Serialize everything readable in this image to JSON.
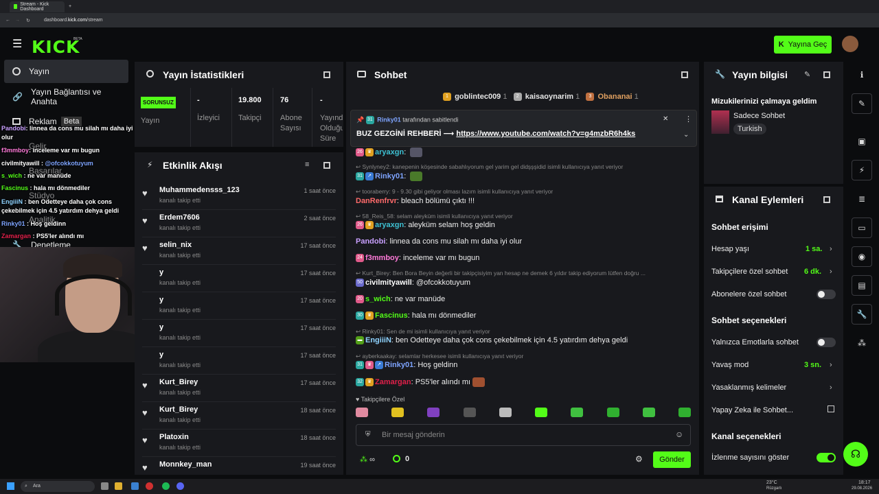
{
  "browser": {
    "tab_title": "Stream - Kick Dashboard",
    "url_prefix": "dashboard.",
    "url_domain": "kick.com",
    "url_path": "/stream"
  },
  "header": {
    "logo": "KICK",
    "beta": "BETA",
    "go_live_label": "Yayına Geç"
  },
  "nav": {
    "items": [
      {
        "label": "Yayın"
      },
      {
        "label": "Yayın Bağlantısı ve Anahta"
      },
      {
        "label": "Reklam",
        "badge": "Beta"
      },
      {
        "label": "Gelir"
      },
      {
        "label": "Başarılar"
      },
      {
        "label": "Stüdyo"
      },
      {
        "label": "Analitik"
      },
      {
        "label": "Denetleme"
      }
    ]
  },
  "overlay_chat": [
    {
      "user": "Pandobi",
      "text": "linnea da cons mu silah mı daha iyi olur"
    },
    {
      "user": "f3mmboy",
      "text": "inceleme var mı bugun"
    },
    {
      "user": "civilmityawill",
      "text": "@ofcokkotuyum"
    },
    {
      "user": "s_wich",
      "text": "ne var manüde"
    },
    {
      "user": "Fascinus",
      "text": "hala mı dönmediler"
    },
    {
      "user": "EngiiiN",
      "text": "ben Odetteye daha çok cons çekebilmek için 4.5 yatırdım dehya geldi"
    },
    {
      "user": "Rinky01",
      "text": "Hoş geldinn"
    },
    {
      "user": "Zamargan",
      "text": "PS5'ler alındı mı"
    }
  ],
  "stats": {
    "title": "Yayın İstatistikleri",
    "status": "SORUNSUZ",
    "status_label": "Yayın",
    "viewers_value": "-",
    "viewers_label": "İzleyici",
    "followers_value": "19.800",
    "followers_label": "Takipçi",
    "subs_value": "76",
    "subs_label": "Abone Sayısı",
    "uptime_value": "-",
    "uptime_label": "Yayında Olduğu Süre"
  },
  "activity": {
    "title": "Etkinlik Akışı",
    "items": [
      {
        "name": "Muhammedensss_123",
        "sub": "kanalı takip etti",
        "time": "1 saat önce"
      },
      {
        "name": "Erdem7606",
        "sub": "kanalı takip etti",
        "time": "2 saat önce"
      },
      {
        "name": "selin_nix",
        "sub": "kanalı takip etti",
        "time": "17 saat önce"
      },
      {
        "name": "y",
        "sub": "kanalı takip etti",
        "time": "17 saat önce"
      },
      {
        "name": "y",
        "sub": "kanalı takip etti",
        "time": "17 saat önce"
      },
      {
        "name": "y",
        "sub": "kanalı takip etti",
        "time": "17 saat önce"
      },
      {
        "name": "y",
        "sub": "kanalı takip etti",
        "time": "17 saat önce"
      },
      {
        "name": "Kurt_Birey",
        "sub": "kanalı takip etti",
        "time": "17 saat önce"
      },
      {
        "name": "Kurt_Birey",
        "sub": "kanalı takip etti",
        "time": "18 saat önce"
      },
      {
        "name": "Platoxin",
        "sub": "kanalı takip etti",
        "time": "18 saat önce"
      },
      {
        "name": "Monnkey_man",
        "sub": "",
        "time": "19 saat önce"
      }
    ]
  },
  "chat": {
    "title": "Sohbet",
    "top_gifters": [
      {
        "rank": "1",
        "name": "goblintec009",
        "count": "1"
      },
      {
        "rank": "2",
        "name": "kaisaoynarim",
        "count": "1"
      },
      {
        "rank": "3",
        "name": "Obananai",
        "count": "1"
      }
    ],
    "pinned": {
      "by_user": "Rinky01",
      "by_text": "tarafından sabitlendi",
      "text": "BUZ GEZGİNİ REHBERİ ⟶",
      "link": "https://www.youtube.com/watch?v=g4mzbR6h4ks"
    },
    "messages": [
      {
        "badge": "26",
        "user": "aryaxgn",
        "text": "",
        "color": "#3ec1d3"
      },
      {
        "reply": "Synlyney2: kanepenin köşesinde sabahlıyorum gel yarim gel didşşşidid isimli kullanıcıya yanıt veriyor"
      },
      {
        "badge": "31",
        "user": "Rinky01",
        "text": "",
        "color": "#7ea4ff"
      },
      {
        "reply": "tooraberry: 9 - 9.30 gibi geliyor olması lazım isimli kullanıcıya yanıt veriyor"
      },
      {
        "badge": "",
        "user": "DanRenfrvr",
        "text": "bleach bölümü çıktı !!!",
        "color": "#ff6b6b"
      },
      {
        "reply": "58_Reis_58: selam aleyküm isimli kullanıcıya yanıt veriyor"
      },
      {
        "badge": "26",
        "user": "aryaxgn",
        "text": "aleyküm selam hoş geldin",
        "color": "#3ec1d3"
      },
      {
        "badge": "",
        "user": "Pandobi",
        "text": "linnea da cons mu silah mı daha iyi olur",
        "color": "#c9a0ff"
      },
      {
        "badge": "24",
        "user": "f3mmboy",
        "text": "inceleme var mı bugun",
        "color": "#ff7ad9"
      },
      {
        "reply": "Kurt_Birey: Ben Bora Beyin değerli bir takipçisiyim yan hesap ne demek 6 yıldır takip ediyorum lütfen doğru ..."
      },
      {
        "badge": "50",
        "user": "civilmityawill",
        "text": "@ofcokkotuyum",
        "color": "#ffffff"
      },
      {
        "badge": "20",
        "user": "s_wich",
        "text": "ne var manüde",
        "color": "#53fc18"
      },
      {
        "badge": "30",
        "user": "Fascinus",
        "text": "hala mı dönmediler",
        "color": "#53fc18"
      },
      {
        "reply": "Rinky01: Sen de mi isimli kullanıcıya yanıt veriyor"
      },
      {
        "badge": "",
        "user": "EngiiiN",
        "text": "ben Odetteye daha çok cons çekebilmek için 4.5 yatırdım dehya geldi",
        "color": "#8fd3ff"
      },
      {
        "reply": "ayberkaakay: selamlar herkesee isimli kullanıcıya yanıt veriyor"
      },
      {
        "badge": "31",
        "user": "Rinky01",
        "text": "Hoş geldinn",
        "color": "#7ea4ff"
      },
      {
        "badge": "32",
        "user": "Zamargan",
        "text": "PS5'ler alındı mı",
        "color": "#e0204a"
      }
    ],
    "followers_only": "Takipçilere Özel",
    "input_placeholder": "Bir mesaj gönderin",
    "points_value": "0",
    "send_label": "Gönder"
  },
  "stream_info": {
    "title": "Yayın bilgisi",
    "stream_title": "Mizukilerinizi çalmaya geldim",
    "category": "Sadece Sohbet",
    "language": "Turkish"
  },
  "channel_actions": {
    "title": "Kanal Eylemleri",
    "chat_access_header": "Sohbet erişimi",
    "account_age_label": "Hesap yaşı",
    "account_age_value": "1 sa.",
    "followers_only_label": "Takipçilere özel sohbet",
    "followers_only_value": "6 dk.",
    "subs_only_label": "Abonelere özel sohbet",
    "chat_options_header": "Sohbet seçenekleri",
    "emote_only_label": "Yalnızca Emotlarla sohbet",
    "slow_mode_label": "Yavaş mod",
    "slow_mode_value": "3 sn.",
    "banned_words_label": "Yasaklanmış kelimeler",
    "ai_chat_label": "Yapay Zeka ile Sohbet...",
    "channel_options_header": "Kanal seçenekleri",
    "show_viewers_label": "İzlenme sayısını göster"
  },
  "taskbar": {
    "search": "Ara",
    "weather": "23°C",
    "weather_sub": "Rüzgarlı",
    "time": "18:17",
    "date": "29.08.2026"
  },
  "colors": {
    "accent": "#53fc18",
    "panel": "#18191d",
    "background": "#0b0c0e"
  }
}
